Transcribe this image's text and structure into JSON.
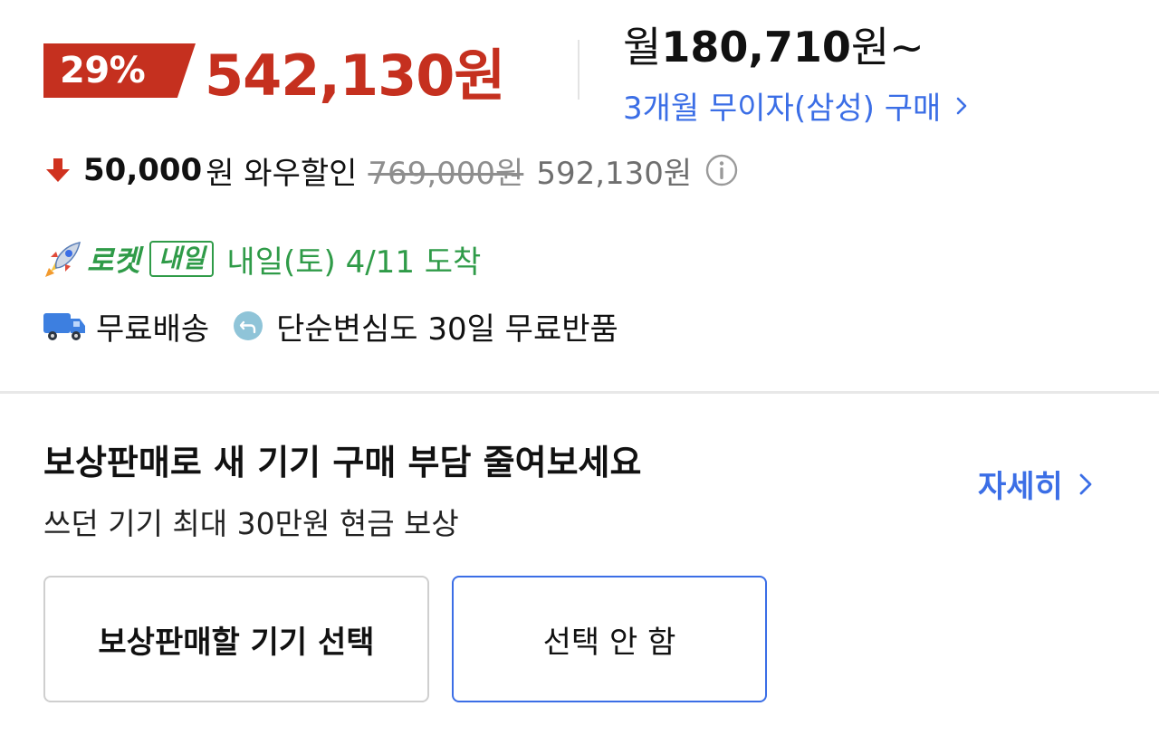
{
  "price": {
    "discount_rate": "29%",
    "sale_price": "542,130원",
    "monthly_prefix": "월",
    "monthly_amount": "180,710",
    "monthly_suffix": "원~",
    "installment_link": "3개월 무이자(삼성) 구매"
  },
  "wow": {
    "amount": "50,000",
    "text": "원 와우할인",
    "original_price": "769,000원",
    "base_price": "592,130원"
  },
  "delivery": {
    "rocket_label": "로켓",
    "tomorrow_badge": "내일",
    "arrival_text": "내일(토) 4/11 도착",
    "shipping_text": "무료배송",
    "return_text": "단순변심도 30일 무료반품"
  },
  "tradein": {
    "title": "보상판매로 새 기기 구매 부담 줄여보세요",
    "subtitle": "쓰던 기기 최대 30만원 현금 보상",
    "detail_link": "자세히",
    "select_device_button": "보상판매할 기기 선택",
    "no_select_button": "선택 안 함"
  },
  "colors": {
    "sale_red": "#c5301f",
    "link_blue": "#3b6ee6",
    "rocket_green": "#2f9b48",
    "muted_gray": "#8e8e8e"
  },
  "icons": {
    "down_arrow": "down-arrow-icon",
    "info": "info-icon",
    "rocket": "rocket-icon",
    "truck": "truck-icon",
    "return": "return-icon",
    "chevron": "chevron-right-icon"
  }
}
